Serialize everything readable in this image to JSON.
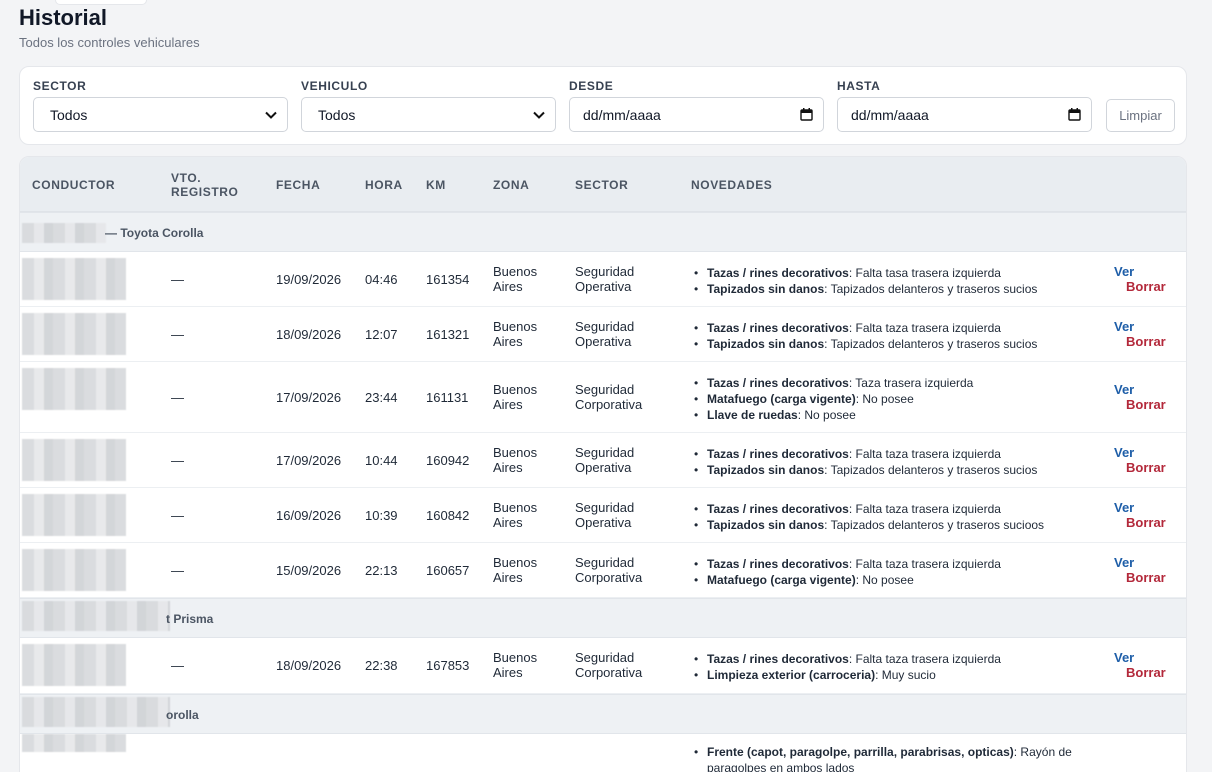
{
  "header": {
    "title": "Historial",
    "subtitle": "Todos los controles vehiculares"
  },
  "filters": {
    "sector": {
      "label": "SECTOR",
      "value": "Todos"
    },
    "vehiculo": {
      "label": "VEHICULO",
      "value": "Todos"
    },
    "desde": {
      "label": "DESDE",
      "value": "dd/mm/aaaa"
    },
    "hasta": {
      "label": "HASTA",
      "value": "dd/mm/aaaa"
    },
    "clear_label": "Limpiar"
  },
  "table": {
    "headers": {
      "conductor": "CONDUCTOR",
      "vto_1": "VTO.",
      "vto_2": "REGISTRO",
      "fecha": "FECHA",
      "hora": "HORA",
      "km": "KM",
      "zona": "ZONA",
      "sector": "SECTOR",
      "novedades": "NOVEDADES"
    },
    "actions": {
      "ver": "Ver",
      "borrar": "Borrar"
    },
    "groups": [
      {
        "label": "— Toyota Corolla"
      },
      {
        "label": "t Prisma"
      },
      {
        "label": "orolla"
      }
    ],
    "rows": [
      {
        "vto": "—",
        "fecha": "19/09/2026",
        "hora": "04:46",
        "km": "161354",
        "zona_1": "Buenos",
        "zona_2": "Aires",
        "sector_1": "Seguridad",
        "sector_2": "Operativa",
        "novedades": [
          {
            "k": "Tazas / rines decorativos",
            "v": ": Falta tasa trasera izquierda"
          },
          {
            "k": "Tapizados sin danos",
            "v": ": Tapizados delanteros y traseros sucios"
          }
        ]
      },
      {
        "vto": "—",
        "fecha": "18/09/2026",
        "hora": "12:07",
        "km": "161321",
        "zona_1": "Buenos",
        "zona_2": "Aires",
        "sector_1": "Seguridad",
        "sector_2": "Operativa",
        "novedades": [
          {
            "k": "Tazas / rines decorativos",
            "v": ": Falta taza trasera izquierda"
          },
          {
            "k": "Tapizados sin danos",
            "v": ": Tapizados delanteros y traseros sucios"
          }
        ]
      },
      {
        "vto": "—",
        "fecha": "17/09/2026",
        "hora": "23:44",
        "km": "161131",
        "zona_1": "Buenos",
        "zona_2": "Aires",
        "sector_1": "Seguridad",
        "sector_2": "Corporativa",
        "novedades": [
          {
            "k": "Tazas / rines decorativos",
            "v": ": Taza trasera izquierda"
          },
          {
            "k": "Matafuego (carga vigente)",
            "v": ": No posee"
          },
          {
            "k": "Llave de ruedas",
            "v": ": No posee"
          }
        ]
      },
      {
        "vto": "—",
        "fecha": "17/09/2026",
        "hora": "10:44",
        "km": "160942",
        "zona_1": "Buenos",
        "zona_2": "Aires",
        "sector_1": "Seguridad",
        "sector_2": "Operativa",
        "novedades": [
          {
            "k": "Tazas / rines decorativos",
            "v": ": Falta taza trasera izquierda"
          },
          {
            "k": "Tapizados sin danos",
            "v": ": Tapizados delanteros y traseros sucios"
          }
        ]
      },
      {
        "vto": "—",
        "fecha": "16/09/2026",
        "hora": "10:39",
        "km": "160842",
        "zona_1": "Buenos",
        "zona_2": "Aires",
        "sector_1": "Seguridad",
        "sector_2": "Operativa",
        "novedades": [
          {
            "k": "Tazas / rines decorativos",
            "v": ": Falta taza trasera izquierda"
          },
          {
            "k": "Tapizados sin danos",
            "v": ": Tapizados delanteros y traseros sucioos"
          }
        ]
      },
      {
        "vto": "—",
        "fecha": "15/09/2026",
        "hora": "22:13",
        "km": "160657",
        "zona_1": "Buenos",
        "zona_2": "Aires",
        "sector_1": "Seguridad",
        "sector_2": "Corporativa",
        "novedades": [
          {
            "k": "Tazas / rines decorativos",
            "v": ": Falta taza trasera izquierda"
          },
          {
            "k": "Matafuego (carga vigente)",
            "v": ": No posee"
          }
        ]
      },
      {
        "vto": "—",
        "fecha": "18/09/2026",
        "hora": "22:38",
        "km": "167853",
        "zona_1": "Buenos",
        "zona_2": "Aires",
        "sector_1": "Seguridad",
        "sector_2": "Corporativa",
        "novedades": [
          {
            "k": "Tazas / rines decorativos",
            "v": ": Falta taza trasera izquierda"
          },
          {
            "k": "Limpieza exterior (carroceria)",
            "v": ": Muy sucio"
          }
        ]
      },
      {
        "vto": "",
        "fecha": "",
        "hora": "",
        "km": "",
        "zona_1": "",
        "zona_2": "",
        "sector_1": "",
        "sector_2": "",
        "novedades": [
          {
            "k": "Frente (capot, paragolpe, parrilla, parabrisas, opticas)",
            "v": ": Rayón de"
          },
          {
            "k": "",
            "v": "paragolpes en ambos lados"
          }
        ]
      }
    ]
  }
}
